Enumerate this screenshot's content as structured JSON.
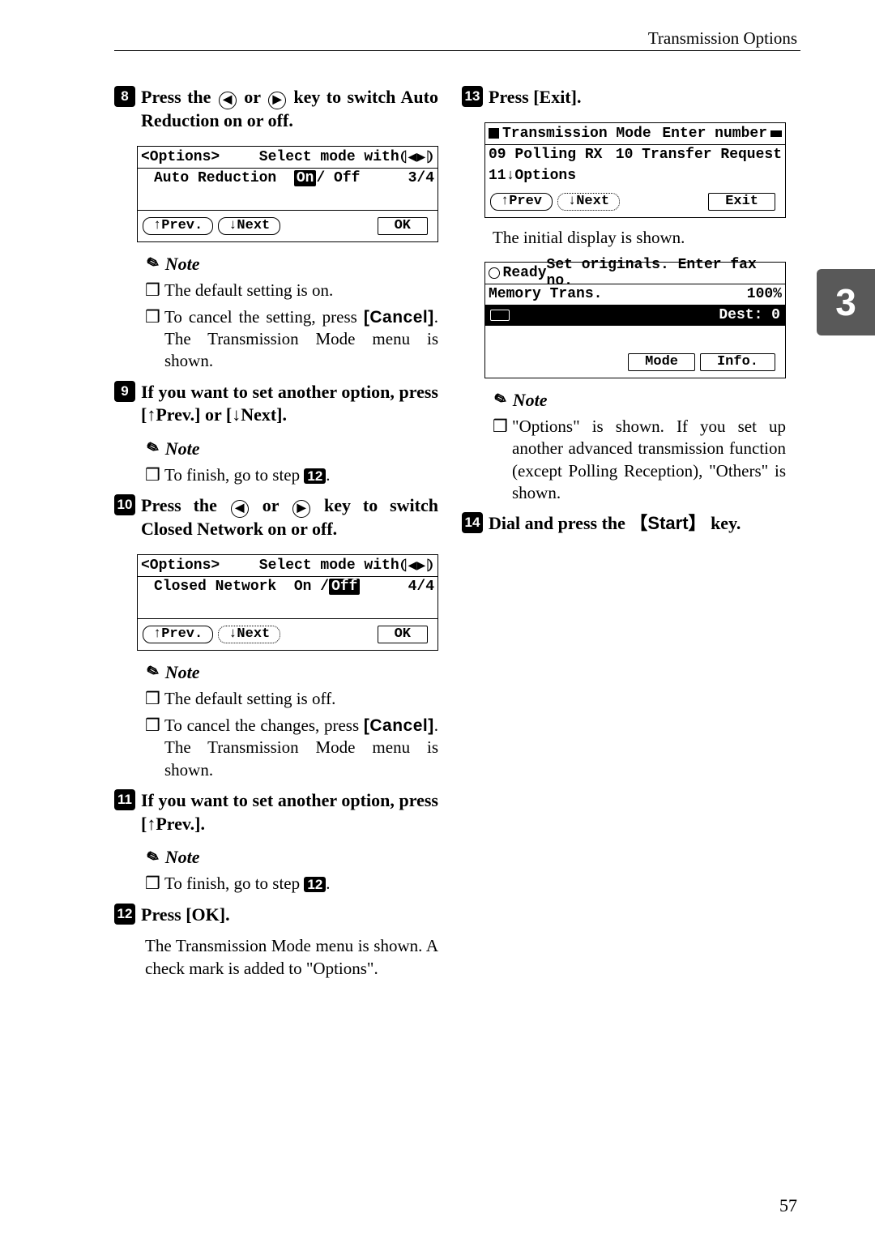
{
  "header": {
    "line_title": "Transmission Options"
  },
  "side_tab": "3",
  "page_number": "57",
  "left": {
    "step8": {
      "num": "8",
      "text_before": "Press the ",
      "text_mid": " or ",
      "text_after": " key to switch Auto Reduction on or off."
    },
    "lcd1": {
      "r1a": "<Options>",
      "r1b": "Select mode with",
      "r2a": "Auto Reduction",
      "r2_on": "On",
      "r2_sep": " / Off",
      "r2_pg": "3/4",
      "btn_prev": "↑Prev.",
      "btn_next": "↓Next",
      "btn_ok": "OK"
    },
    "note1": {
      "title": "Note",
      "item1": "The default setting is on.",
      "item2_a": "To cancel the setting, press ",
      "item2_b": "[Cancel]",
      "item2_c": ". The Transmission Mode menu is shown."
    },
    "step9": {
      "num": "9",
      "text": "If you want to set another option, press [↑Prev.] or [↓Next]."
    },
    "note2": {
      "title": "Note",
      "item1_a": "To finish, go to step ",
      "item1_b": "12",
      "item1_c": "."
    },
    "step10": {
      "num": "10",
      "text_before": "Press the ",
      "text_mid": " or ",
      "text_after": " key to switch Closed Network on or off."
    },
    "lcd2": {
      "r1a": "<Options>",
      "r1b": "Select mode with",
      "r2a": "Closed Network",
      "r2_on": "On / ",
      "r2_off": "Off",
      "r2_pg": "4/4",
      "btn_prev": "↑Prev.",
      "btn_next": "↓Next",
      "btn_ok": "OK"
    },
    "note3": {
      "title": "Note",
      "item1": "The default setting is off.",
      "item2_a": "To cancel the changes, press ",
      "item2_b": "[Cancel]",
      "item2_c": ". The Transmission Mode menu is shown."
    },
    "step11": {
      "num": "11",
      "text": "If you want to set another option, press [↑Prev.]."
    },
    "note4": {
      "title": "Note",
      "item1_a": "To finish, go to step ",
      "item1_b": "12",
      "item1_c": "."
    },
    "step12": {
      "num": "12",
      "text": "Press [OK]."
    },
    "step12_sub": "The Transmission Mode menu is shown. A check mark is added to \"Options\"."
  },
  "right": {
    "step13": {
      "num": "13",
      "text": "Press [Exit]."
    },
    "lcd3": {
      "r1a": "Transmission Mode",
      "r1b": "Enter number",
      "r2a": "09 Polling RX",
      "r2b": "10 Transfer Request",
      "r3a": "11↓Options",
      "btn_prev": "↑Prev",
      "btn_next": "↓Next",
      "btn_exit": "Exit"
    },
    "lcd3_sub": "The initial display is shown.",
    "lcd4": {
      "r1a": "Ready",
      "r1b": "Set originals. Enter fax no.",
      "r2a": "Memory Trans.",
      "r2b": "100%",
      "r3b": "Dest:  0",
      "btn_mode": "Mode",
      "btn_info": "Info."
    },
    "note5": {
      "title": "Note",
      "item1": "\"Options\" is shown. If you set up another advanced transmission function (except Polling Reception), \"Others\" is shown."
    },
    "step14": {
      "num": "14",
      "text_a": "Dial and press the ",
      "text_key": "Start",
      "text_c": " key."
    }
  }
}
